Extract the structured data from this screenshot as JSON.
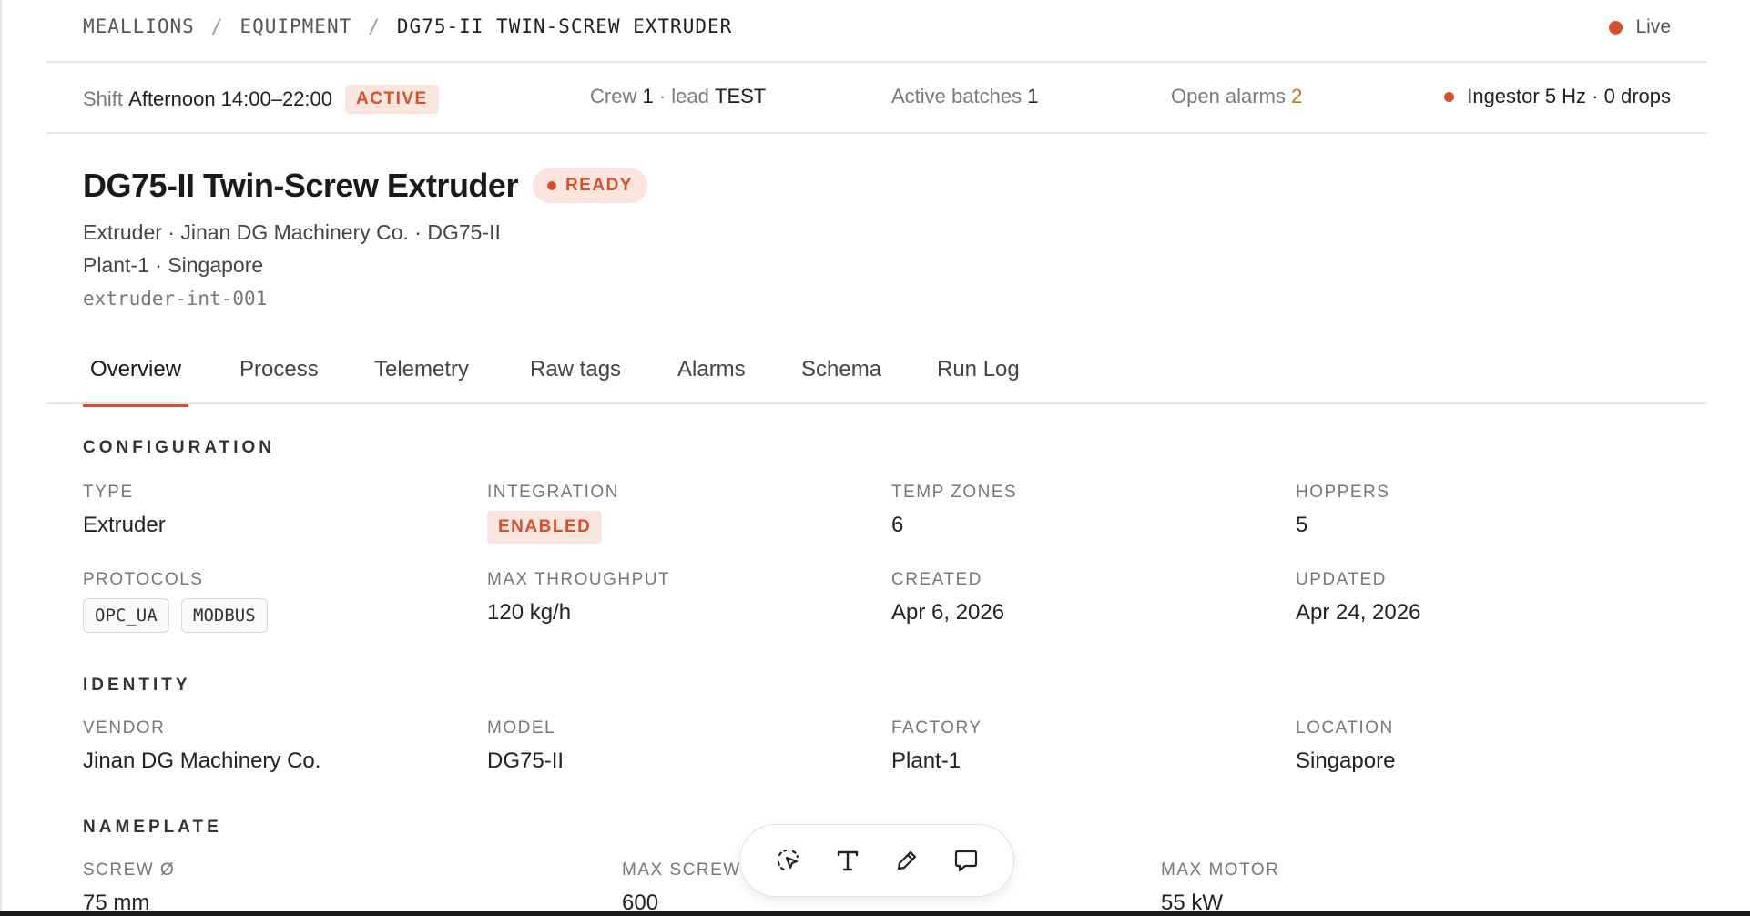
{
  "breadcrumb": {
    "items": [
      "MEALLIONS",
      "EQUIPMENT",
      "DG75-II TWIN-SCREW EXTRUDER"
    ],
    "separator": "/",
    "live_label": "Live"
  },
  "status_bar": {
    "shift_label": "Shift",
    "shift_value": "Afternoon 14:00–22:00",
    "shift_badge": "ACTIVE",
    "crew_label": "Crew",
    "crew_value": "1",
    "lead_label": "· lead",
    "lead_value": "TEST",
    "batches_label": "Active batches",
    "batches_value": "1",
    "alarms_label": "Open alarms",
    "alarms_value": "2",
    "ingestor_text": "Ingestor 5 Hz · 0 drops"
  },
  "header": {
    "title": "DG75-II Twin-Screw Extruder",
    "status_badge": "READY",
    "subtitle_line1": "Extruder · Jinan DG Machinery Co. · DG75-II",
    "subtitle_line2": "Plant-1 · Singapore",
    "device_id": "extruder-int-001"
  },
  "tabs": [
    {
      "label": "Overview",
      "active": true
    },
    {
      "label": "Process"
    },
    {
      "label": "Telemetry"
    },
    {
      "label": "Raw tags"
    },
    {
      "label": "Alarms"
    },
    {
      "label": "Schema"
    },
    {
      "label": "Run Log"
    }
  ],
  "configuration": {
    "heading": "CONFIGURATION",
    "type_label": "TYPE",
    "type_value": "Extruder",
    "integration_label": "INTEGRATION",
    "integration_value": "ENABLED",
    "temp_zones_label": "TEMP ZONES",
    "temp_zones_value": "6",
    "hoppers_label": "HOPPERS",
    "hoppers_value": "5",
    "protocols_label": "PROTOCOLS",
    "protocols": [
      "OPC_UA",
      "MODBUS"
    ],
    "max_throughput_label": "MAX THROUGHPUT",
    "max_throughput_value": "120 kg/h",
    "created_label": "CREATED",
    "created_value": "Apr 6, 2026",
    "updated_label": "UPDATED",
    "updated_value": "Apr 24, 2026"
  },
  "identity": {
    "heading": "IDENTITY",
    "vendor_label": "VENDOR",
    "vendor_value": "Jinan DG Machinery Co.",
    "model_label": "MODEL",
    "model_value": "DG75-II",
    "factory_label": "FACTORY",
    "factory_value": "Plant-1",
    "location_label": "LOCATION",
    "location_value": "Singapore"
  },
  "nameplate": {
    "heading": "NAMEPLATE",
    "screw_label": "SCREW Ø",
    "screw_value": "75 mm",
    "max_screw_label": "MAX SCREW",
    "max_screw_value": "600",
    "max_motor_label": "MAX MOTOR",
    "max_motor_value": "55 kW"
  },
  "colors": {
    "accent": "#d5502c",
    "accent_bg": "#fbe6df",
    "alarm_amber": "#c07a14"
  },
  "toolbar": {
    "tools": [
      "select-icon",
      "text-icon",
      "pencil-icon",
      "comment-icon"
    ]
  }
}
